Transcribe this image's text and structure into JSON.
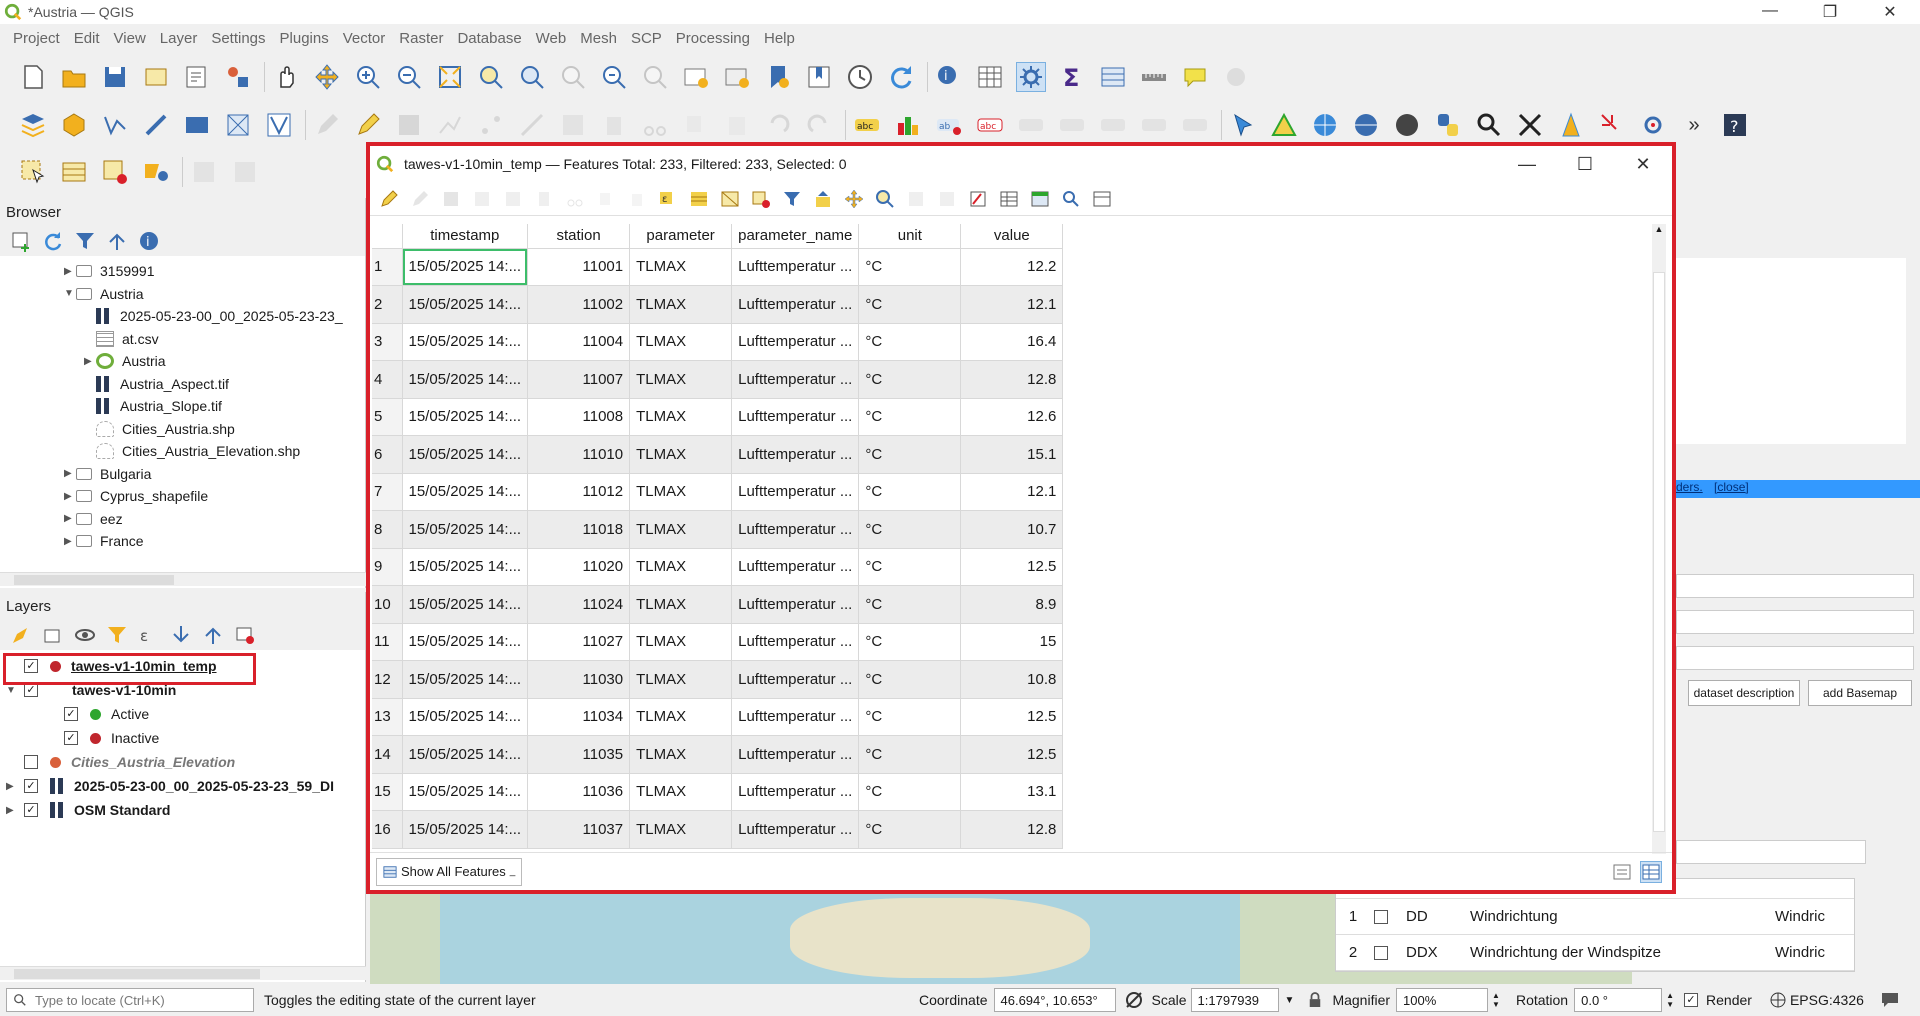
{
  "app": {
    "title": "*Austria — QGIS",
    "window_controls": [
      "—",
      "❐",
      "✕"
    ]
  },
  "menu": [
    "Project",
    "Edit",
    "View",
    "Layer",
    "Settings",
    "Plugins",
    "Vector",
    "Raster",
    "Database",
    "Web",
    "Mesh",
    "SCP",
    "Processing",
    "Help"
  ],
  "browser": {
    "title": "Browser",
    "items": [
      {
        "label": "3159991",
        "type": "folder",
        "indent": 1,
        "expander": "▶"
      },
      {
        "label": "Austria",
        "type": "folder",
        "indent": 1,
        "expander": "▼"
      },
      {
        "label": "2025-05-23-00_00_2025-05-23-23_",
        "type": "raster",
        "indent": 2,
        "expander": ""
      },
      {
        "label": "at.csv",
        "type": "csv",
        "indent": 2,
        "expander": ""
      },
      {
        "label": "Austria",
        "type": "qgs",
        "indent": 2,
        "expander": "▶"
      },
      {
        "label": "Austria_Aspect.tif",
        "type": "raster",
        "indent": 2,
        "expander": ""
      },
      {
        "label": "Austria_Slope.tif",
        "type": "raster",
        "indent": 2,
        "expander": ""
      },
      {
        "label": "Cities_Austria.shp",
        "type": "shp",
        "indent": 2,
        "expander": ""
      },
      {
        "label": "Cities_Austria_Elevation.shp",
        "type": "shp",
        "indent": 2,
        "expander": ""
      },
      {
        "label": "Bulgaria",
        "type": "folder",
        "indent": 1,
        "expander": "▶"
      },
      {
        "label": "Cyprus_shapefile",
        "type": "folder",
        "indent": 1,
        "expander": "▶"
      },
      {
        "label": "eez",
        "type": "folder",
        "indent": 1,
        "expander": "▶"
      },
      {
        "label": "France",
        "type": "folder",
        "indent": 1,
        "expander": "▶"
      }
    ]
  },
  "layers": {
    "title": "Layers",
    "items": [
      {
        "label": "tawes-v1-10min_temp",
        "checked": true,
        "symbol": "#c0262d",
        "indent": 0,
        "expander": "",
        "style": "bold-underline"
      },
      {
        "label": "tawes-v1-10min",
        "checked": true,
        "symbol": "",
        "indent": 0,
        "expander": "▼",
        "style": "bold"
      },
      {
        "label": "Active",
        "checked": true,
        "symbol": "#2ea62e",
        "indent": 1,
        "expander": "",
        "style": "normal"
      },
      {
        "label": "Inactive",
        "checked": true,
        "symbol": "#c0262d",
        "indent": 1,
        "expander": "",
        "style": "normal"
      },
      {
        "label": "Cities_Austria_Elevation",
        "checked": false,
        "symbol": "#d9603b",
        "indent": 0,
        "expander": "",
        "style": "italic"
      },
      {
        "label": "2025-05-23-00_00_2025-05-23-23_59_DI",
        "checked": true,
        "symbol": "raster",
        "indent": 0,
        "expander": "▶",
        "style": "bold"
      },
      {
        "label": "OSM Standard",
        "checked": true,
        "symbol": "raster",
        "indent": 0,
        "expander": "▶",
        "style": "bold"
      }
    ]
  },
  "attribute_table": {
    "title": "tawes-v1-10min_temp — Features Total: 233, Filtered: 233, Selected: 0",
    "columns": [
      "timestamp",
      "station",
      "parameter",
      "parameter_name",
      "unit",
      "value"
    ],
    "rows": [
      [
        "1",
        "15/05/2025 14:...",
        "11001",
        "TLMAX",
        "Lufttemperatur ...",
        "°C",
        "12.2"
      ],
      [
        "2",
        "15/05/2025 14:...",
        "11002",
        "TLMAX",
        "Lufttemperatur ...",
        "°C",
        "12.1"
      ],
      [
        "3",
        "15/05/2025 14:...",
        "11004",
        "TLMAX",
        "Lufttemperatur ...",
        "°C",
        "16.4"
      ],
      [
        "4",
        "15/05/2025 14:...",
        "11007",
        "TLMAX",
        "Lufttemperatur ...",
        "°C",
        "12.8"
      ],
      [
        "5",
        "15/05/2025 14:...",
        "11008",
        "TLMAX",
        "Lufttemperatur ...",
        "°C",
        "12.6"
      ],
      [
        "6",
        "15/05/2025 14:...",
        "11010",
        "TLMAX",
        "Lufttemperatur ...",
        "°C",
        "15.1"
      ],
      [
        "7",
        "15/05/2025 14:...",
        "11012",
        "TLMAX",
        "Lufttemperatur ...",
        "°C",
        "12.1"
      ],
      [
        "8",
        "15/05/2025 14:...",
        "11018",
        "TLMAX",
        "Lufttemperatur ...",
        "°C",
        "10.7"
      ],
      [
        "9",
        "15/05/2025 14:...",
        "11020",
        "TLMAX",
        "Lufttemperatur ...",
        "°C",
        "12.5"
      ],
      [
        "10",
        "15/05/2025 14:...",
        "11024",
        "TLMAX",
        "Lufttemperatur ...",
        "°C",
        "8.9"
      ],
      [
        "11",
        "15/05/2025 14:...",
        "11027",
        "TLMAX",
        "Lufttemperatur ...",
        "°C",
        "15"
      ],
      [
        "12",
        "15/05/2025 14:...",
        "11030",
        "TLMAX",
        "Lufttemperatur ...",
        "°C",
        "10.8"
      ],
      [
        "13",
        "15/05/2025 14:...",
        "11034",
        "TLMAX",
        "Lufttemperatur ...",
        "°C",
        "12.5"
      ],
      [
        "14",
        "15/05/2025 14:...",
        "11035",
        "TLMAX",
        "Lufttemperatur ...",
        "°C",
        "12.5"
      ],
      [
        "15",
        "15/05/2025 14:...",
        "11036",
        "TLMAX",
        "Lufttemperatur ...",
        "°C",
        "13.1"
      ],
      [
        "16",
        "15/05/2025 14:...",
        "11037",
        "TLMAX",
        "Lufttemperatur ...",
        "°C",
        "12.8"
      ]
    ],
    "show_all_label": "Show All Features"
  },
  "right_dock": {
    "message_links": [
      "ders.",
      "[close]"
    ],
    "buttons": {
      "dataset_description": "dataset description",
      "add_basemap": "add Basemap"
    },
    "table_rows": [
      {
        "num": "1",
        "code": "DD",
        "name": "Windrichtung",
        "extra": "Windric"
      },
      {
        "num": "2",
        "code": "DDX",
        "name": "Windrichtung der Windspitze",
        "extra": "Windric"
      }
    ]
  },
  "status": {
    "locate_placeholder": "Type to locate (Ctrl+K)",
    "message": "Toggles the editing state of the current layer",
    "coordinate_label": "Coordinate",
    "coordinate_value": "46.694°, 10.653°",
    "scale_label": "Scale",
    "scale_value": "1:1797939",
    "magnifier_label": "Magnifier",
    "magnifier_value": "100%",
    "rotation_label": "Rotation",
    "rotation_value": "0.0 °",
    "render_label": "Render",
    "crs": "EPSG:4326"
  },
  "colors": {
    "highlight_red": "#d9202a",
    "qgis_green": "#6fae3b",
    "selection_blue": "#3399ff"
  }
}
